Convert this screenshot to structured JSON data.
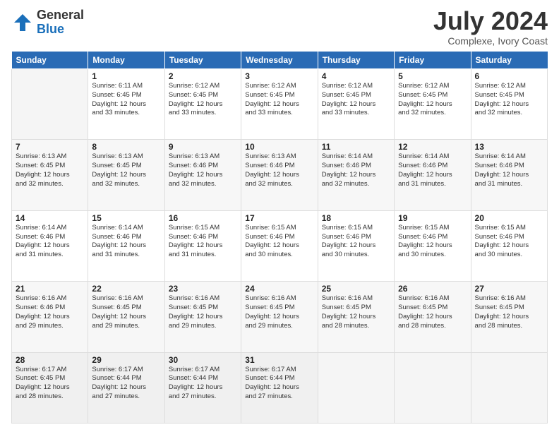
{
  "logo": {
    "general": "General",
    "blue": "Blue"
  },
  "title": "July 2024",
  "subtitle": "Complexe, Ivory Coast",
  "days_of_week": [
    "Sunday",
    "Monday",
    "Tuesday",
    "Wednesday",
    "Thursday",
    "Friday",
    "Saturday"
  ],
  "weeks": [
    [
      {
        "day": "",
        "info": ""
      },
      {
        "day": "1",
        "info": "Sunrise: 6:11 AM\nSunset: 6:45 PM\nDaylight: 12 hours\nand 33 minutes."
      },
      {
        "day": "2",
        "info": "Sunrise: 6:12 AM\nSunset: 6:45 PM\nDaylight: 12 hours\nand 33 minutes."
      },
      {
        "day": "3",
        "info": "Sunrise: 6:12 AM\nSunset: 6:45 PM\nDaylight: 12 hours\nand 33 minutes."
      },
      {
        "day": "4",
        "info": "Sunrise: 6:12 AM\nSunset: 6:45 PM\nDaylight: 12 hours\nand 33 minutes."
      },
      {
        "day": "5",
        "info": "Sunrise: 6:12 AM\nSunset: 6:45 PM\nDaylight: 12 hours\nand 32 minutes."
      },
      {
        "day": "6",
        "info": "Sunrise: 6:12 AM\nSunset: 6:45 PM\nDaylight: 12 hours\nand 32 minutes."
      }
    ],
    [
      {
        "day": "7",
        "info": "Sunrise: 6:13 AM\nSunset: 6:45 PM\nDaylight: 12 hours\nand 32 minutes."
      },
      {
        "day": "8",
        "info": "Sunrise: 6:13 AM\nSunset: 6:45 PM\nDaylight: 12 hours\nand 32 minutes."
      },
      {
        "day": "9",
        "info": "Sunrise: 6:13 AM\nSunset: 6:46 PM\nDaylight: 12 hours\nand 32 minutes."
      },
      {
        "day": "10",
        "info": "Sunrise: 6:13 AM\nSunset: 6:46 PM\nDaylight: 12 hours\nand 32 minutes."
      },
      {
        "day": "11",
        "info": "Sunrise: 6:14 AM\nSunset: 6:46 PM\nDaylight: 12 hours\nand 32 minutes."
      },
      {
        "day": "12",
        "info": "Sunrise: 6:14 AM\nSunset: 6:46 PM\nDaylight: 12 hours\nand 31 minutes."
      },
      {
        "day": "13",
        "info": "Sunrise: 6:14 AM\nSunset: 6:46 PM\nDaylight: 12 hours\nand 31 minutes."
      }
    ],
    [
      {
        "day": "14",
        "info": "Sunrise: 6:14 AM\nSunset: 6:46 PM\nDaylight: 12 hours\nand 31 minutes."
      },
      {
        "day": "15",
        "info": "Sunrise: 6:14 AM\nSunset: 6:46 PM\nDaylight: 12 hours\nand 31 minutes."
      },
      {
        "day": "16",
        "info": "Sunrise: 6:15 AM\nSunset: 6:46 PM\nDaylight: 12 hours\nand 31 minutes."
      },
      {
        "day": "17",
        "info": "Sunrise: 6:15 AM\nSunset: 6:46 PM\nDaylight: 12 hours\nand 30 minutes."
      },
      {
        "day": "18",
        "info": "Sunrise: 6:15 AM\nSunset: 6:46 PM\nDaylight: 12 hours\nand 30 minutes."
      },
      {
        "day": "19",
        "info": "Sunrise: 6:15 AM\nSunset: 6:46 PM\nDaylight: 12 hours\nand 30 minutes."
      },
      {
        "day": "20",
        "info": "Sunrise: 6:15 AM\nSunset: 6:46 PM\nDaylight: 12 hours\nand 30 minutes."
      }
    ],
    [
      {
        "day": "21",
        "info": "Sunrise: 6:16 AM\nSunset: 6:46 PM\nDaylight: 12 hours\nand 29 minutes."
      },
      {
        "day": "22",
        "info": "Sunrise: 6:16 AM\nSunset: 6:45 PM\nDaylight: 12 hours\nand 29 minutes."
      },
      {
        "day": "23",
        "info": "Sunrise: 6:16 AM\nSunset: 6:45 PM\nDaylight: 12 hours\nand 29 minutes."
      },
      {
        "day": "24",
        "info": "Sunrise: 6:16 AM\nSunset: 6:45 PM\nDaylight: 12 hours\nand 29 minutes."
      },
      {
        "day": "25",
        "info": "Sunrise: 6:16 AM\nSunset: 6:45 PM\nDaylight: 12 hours\nand 28 minutes."
      },
      {
        "day": "26",
        "info": "Sunrise: 6:16 AM\nSunset: 6:45 PM\nDaylight: 12 hours\nand 28 minutes."
      },
      {
        "day": "27",
        "info": "Sunrise: 6:16 AM\nSunset: 6:45 PM\nDaylight: 12 hours\nand 28 minutes."
      }
    ],
    [
      {
        "day": "28",
        "info": "Sunrise: 6:17 AM\nSunset: 6:45 PM\nDaylight: 12 hours\nand 28 minutes."
      },
      {
        "day": "29",
        "info": "Sunrise: 6:17 AM\nSunset: 6:44 PM\nDaylight: 12 hours\nand 27 minutes."
      },
      {
        "day": "30",
        "info": "Sunrise: 6:17 AM\nSunset: 6:44 PM\nDaylight: 12 hours\nand 27 minutes."
      },
      {
        "day": "31",
        "info": "Sunrise: 6:17 AM\nSunset: 6:44 PM\nDaylight: 12 hours\nand 27 minutes."
      },
      {
        "day": "",
        "info": ""
      },
      {
        "day": "",
        "info": ""
      },
      {
        "day": "",
        "info": ""
      }
    ]
  ]
}
